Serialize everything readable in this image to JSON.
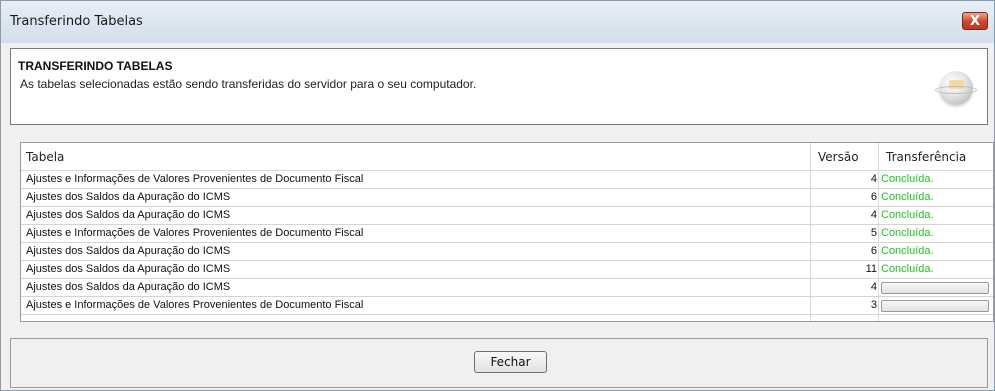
{
  "window": {
    "title": "Transferindo Tabelas",
    "close_label": "X"
  },
  "header": {
    "title": "TRANSFERINDO TABELAS",
    "description": "As tabelas selecionadas estão sendo transferidas do servidor para o seu computador.",
    "icon": "globe-icon"
  },
  "table": {
    "columns": [
      "Tabela",
      "Versão",
      "Transferência"
    ],
    "rows": [
      {
        "name": "Ajustes e Informações de Valores Provenientes de Documento Fiscal",
        "version": "4",
        "status": "Concluída.",
        "progress": 1
      },
      {
        "name": "Ajustes dos Saldos da Apuração do ICMS",
        "version": "6",
        "status": "Concluída.",
        "progress": 1
      },
      {
        "name": "Ajustes dos Saldos da Apuração do ICMS",
        "version": "4",
        "status": "Concluída.",
        "progress": 1
      },
      {
        "name": "Ajustes e Informações de Valores Provenientes de Documento Fiscal",
        "version": "5",
        "status": "Concluída.",
        "progress": 1
      },
      {
        "name": "Ajustes dos Saldos da Apuração do ICMS",
        "version": "6",
        "status": "Concluída.",
        "progress": 1
      },
      {
        "name": "Ajustes dos Saldos da Apuração do ICMS",
        "version": "11",
        "status": "Concluída.",
        "progress": 1
      },
      {
        "name": "Ajustes dos Saldos da Apuração do ICMS",
        "version": "4",
        "status": "",
        "progress": 0
      },
      {
        "name": "Ajustes e Informações de Valores Provenientes de Documento Fiscal",
        "version": "3",
        "status": "",
        "progress": 0
      }
    ]
  },
  "footer": {
    "close_button_label": "Fechar"
  },
  "colors": {
    "status_done": "#21c22b",
    "titlebar": "#dbe4ef",
    "close_button": "#c9472b"
  }
}
